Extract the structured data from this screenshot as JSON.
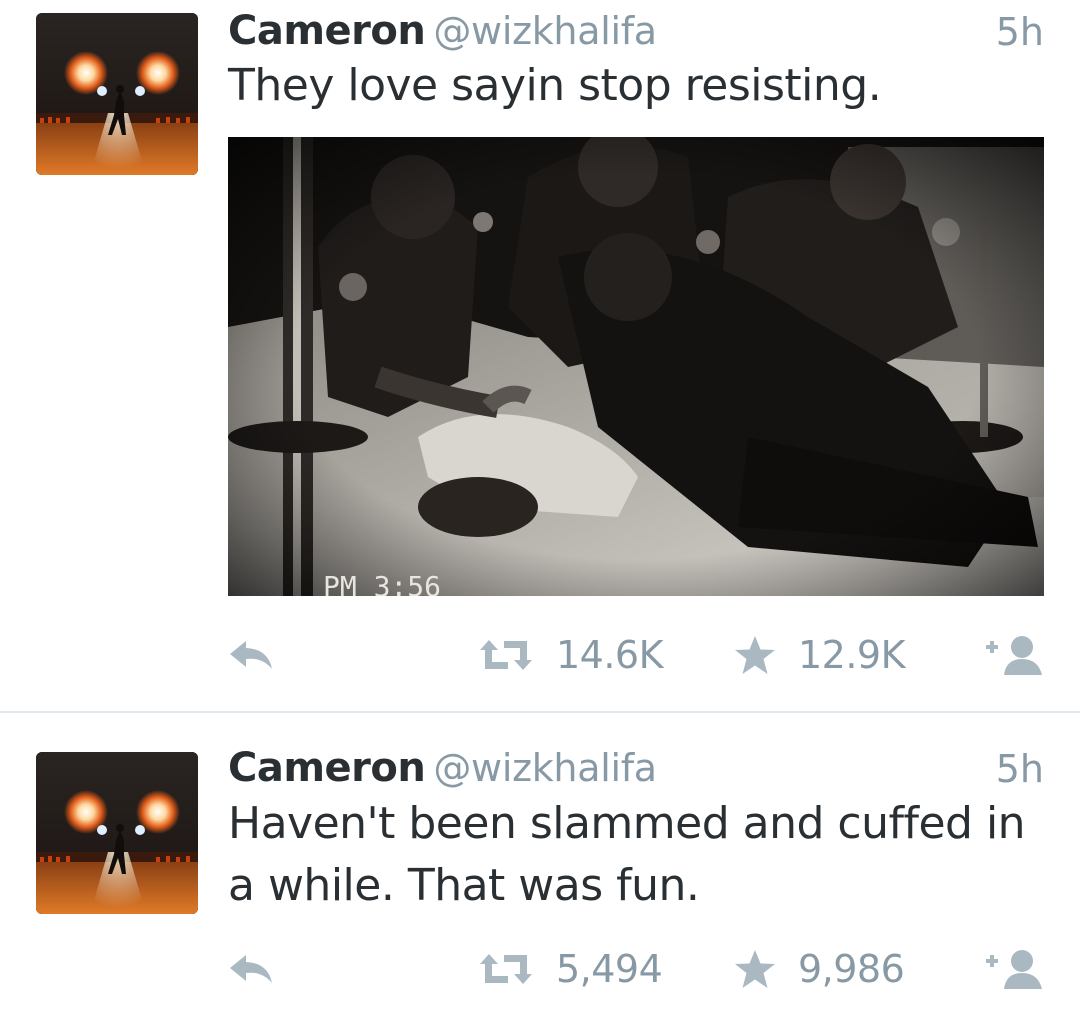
{
  "tweets": [
    {
      "name": "Cameron",
      "handle": "@wizkhalifa",
      "time": "5h",
      "text": "They love sayin stop resisting.",
      "media_caption": "PM   3:56",
      "retweets": "14.6K",
      "favorites": "12.9K"
    },
    {
      "name": "Cameron",
      "handle": "@wizkhalifa",
      "time": "5h",
      "text": "Haven't been slammed and cuffed in a while. That was fun.",
      "retweets": "5,494",
      "favorites": "9,986"
    }
  ],
  "icons": {
    "reply": "reply-icon",
    "retweet": "retweet-icon",
    "favorite": "star-icon",
    "follow": "follow-user-icon"
  },
  "colors": {
    "text": "#292f33",
    "muted": "#8899a6",
    "icon": "#aab8c2",
    "divider": "#e1e8ed"
  }
}
